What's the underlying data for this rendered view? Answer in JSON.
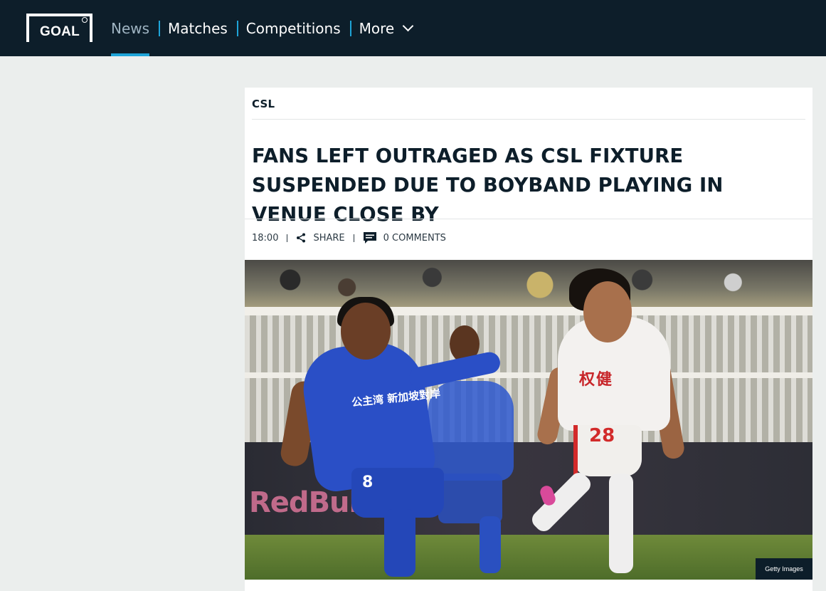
{
  "header": {
    "logo_text": "GOAL",
    "nav": [
      {
        "label": "News",
        "active": true
      },
      {
        "label": "Matches",
        "active": false
      },
      {
        "label": "Competitions",
        "active": false
      },
      {
        "label": "More",
        "active": false,
        "dropdown": true
      }
    ],
    "colors": {
      "background": "#0d1e2a",
      "accent": "#1ea4d8"
    }
  },
  "article": {
    "category": "CSL",
    "headline": "FANS LEFT OUTRAGED AS CSL FIXTURE SUSPENDED DUE TO BOYBAND PLAYING IN VENUE CLOSE BY",
    "time": "18:00",
    "share_label": "SHARE",
    "comments_label": "0 COMMENTS",
    "image": {
      "credit": "Getty Images",
      "player_left_shirt_text": "公主湾 新加坡對岸",
      "player_left_number": "8",
      "player_right_shirt_text": "权健",
      "player_right_number": "28",
      "board_text_left": "RedBull"
    }
  },
  "icons": {
    "logo": "goal-logo-icon",
    "more": "chevron-down-icon",
    "share": "share-icon",
    "comments": "comment-icon"
  }
}
